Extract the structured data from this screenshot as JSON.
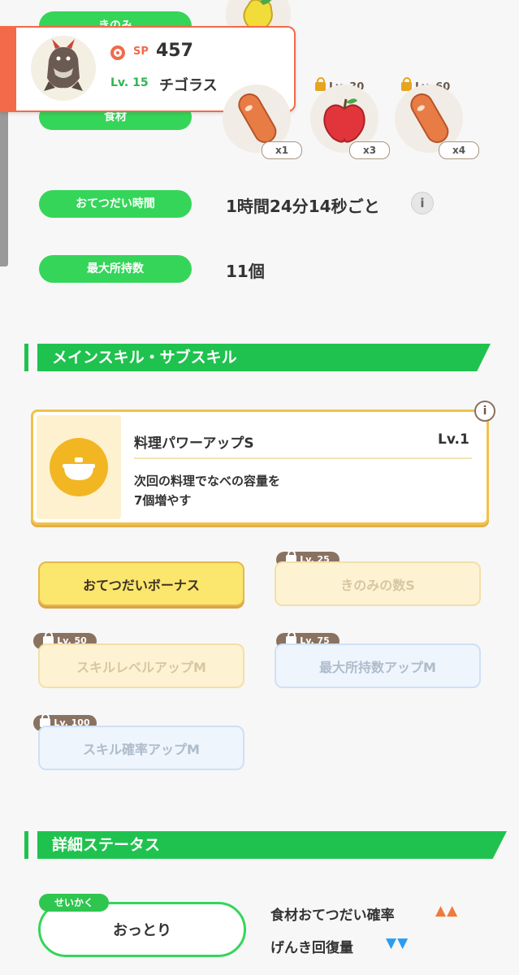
{
  "pokemon_card": {
    "sp_label": "SP",
    "sp_value": "457",
    "level_label": "Lv. 15",
    "name": "チゴラス"
  },
  "rows": {
    "berry_label": "きのみ",
    "ingredients_label": "食材",
    "help_time_label": "おてつだい時間",
    "help_time_value": "1時間24分14秒ごと",
    "max_carry_label": "最大所持数",
    "max_carry_value": "11個"
  },
  "ingredients": [
    {
      "name": "sausage",
      "count": "x1",
      "lock_level": ""
    },
    {
      "name": "apple",
      "count": "x3",
      "lock_level": "Lv. 30"
    },
    {
      "name": "sausage",
      "count": "x4",
      "lock_level": "Lv. 60"
    }
  ],
  "sections": {
    "skills_title": "メインスキル・サブスキル",
    "details_title": "詳細ステータス"
  },
  "main_skill": {
    "name": "料理パワーアップS",
    "level": "Lv.1",
    "desc_line1": "次回の料理でなべの容量を",
    "desc_line2": "7個増やす"
  },
  "subskills": [
    {
      "label": "おてつだいボーナス",
      "lock": ""
    },
    {
      "label": "きのみの数S",
      "lock": "Lv. 25"
    },
    {
      "label": "スキルレベルアップM",
      "lock": "Lv. 50"
    },
    {
      "label": "最大所持数アップM",
      "lock": "Lv. 75"
    },
    {
      "label": "スキル確率アップM",
      "lock": "Lv. 100"
    }
  ],
  "nature": {
    "tag": "せいかく",
    "value": "おっとり",
    "up_label": "食材おてつだい確率",
    "up_marks": "▲▲",
    "down_label": "げんき回復量",
    "down_marks": "▼▼"
  },
  "colors": {
    "accent_green": "#20c24f",
    "pill_green": "#35d55a",
    "up_orange": "#f07a3a",
    "down_blue": "#2b9cf0"
  }
}
